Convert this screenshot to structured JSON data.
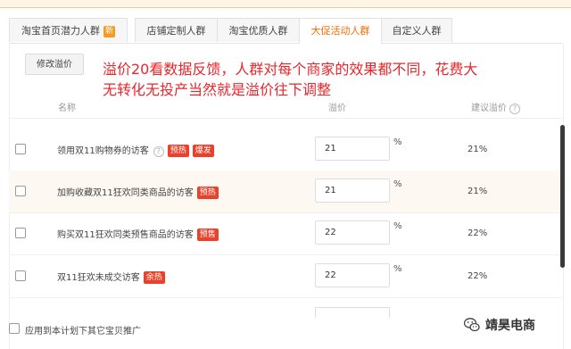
{
  "tabs": [
    {
      "label": "淘宝首页潜力人群",
      "badge": "新"
    },
    {
      "label": "店铺定制人群"
    },
    {
      "label": "淘宝优质人群"
    },
    {
      "label": "大促活动人群"
    },
    {
      "label": "自定义人群"
    }
  ],
  "active_tab": "大促活动人群",
  "toolbar": {
    "adjust_label": "修改溢价"
  },
  "annotation": {
    "line1": "溢价20看数据反馈，人群对每个商家的效果都不同，花费大",
    "line2": "无转化无投产当然就是溢价往下调整"
  },
  "table": {
    "headers": {
      "name": "名称",
      "premium": "溢价",
      "suggested": "建议溢价"
    },
    "rows": [
      {
        "name": "领用双11购物券的访客",
        "help": "?",
        "tags": [
          "预热",
          "爆发"
        ],
        "premium": "21",
        "unit": "%",
        "suggested": "21%"
      },
      {
        "name": "加购收藏双11狂欢同类商品的访客",
        "tags": [
          "预热"
        ],
        "premium": "21",
        "unit": "%",
        "suggested": "21%"
      },
      {
        "name": "购买双11狂欢同类预售商品的访客",
        "tags": [
          "预售"
        ],
        "premium": "22",
        "unit": "%",
        "suggested": "22%"
      },
      {
        "name": "双11狂欢未成交访客",
        "tags": [
          "余热"
        ],
        "premium": "22",
        "unit": "%",
        "suggested": "22%"
      }
    ]
  },
  "footer": {
    "apply_label": "应用到本计划下其它宝贝推广"
  },
  "watermark": {
    "text": "靖昊电商"
  },
  "colors": {
    "accent": "#ff6a00",
    "tag": "#e8412c",
    "annotation": "#e8262c",
    "badge": "#f59a23"
  }
}
